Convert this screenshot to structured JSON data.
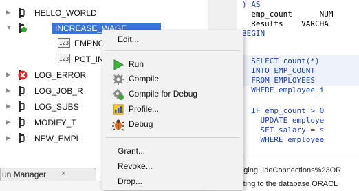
{
  "tree": {
    "items": [
      {
        "label": "HELLO_WORLD",
        "icon": "procedure-icon"
      },
      {
        "label": "INCREASE_WAGE",
        "icon": "procedure-debug-icon",
        "selected": true
      },
      {
        "label": "EMPNO",
        "icon": "parameter-icon"
      },
      {
        "label": "PCT_IN",
        "icon": "parameter-icon"
      },
      {
        "label": "LOG_ERROR",
        "icon": "procedure-error-icon"
      },
      {
        "label": "LOG_JOB_R",
        "icon": "procedure-icon"
      },
      {
        "label": "LOG_SUBS",
        "icon": "procedure-icon"
      },
      {
        "label": "MODIFY_T",
        "icon": "procedure-icon"
      },
      {
        "label": "NEW_EMPL",
        "icon": "procedure-icon"
      }
    ],
    "param_badge": "123"
  },
  "context_menu": {
    "edit": "Edit...",
    "run": "Run",
    "compile": "Compile",
    "compile_debug": "Compile for Debug",
    "profile": "Profile...",
    "debug": "Debug",
    "grant": "Grant...",
    "revoke": "Revoke...",
    "drop": "Drop..."
  },
  "editor": {
    "lines": [
      {
        "t": ") AS",
        "kw": true
      },
      {
        "t": "  emp_count      NUM",
        "kw": false
      },
      {
        "t": "  Results    VARCHA",
        "kw": false
      },
      {
        "t": "BEGIN",
        "kw": true
      },
      {
        "t": "",
        "kw": false
      },
      {
        "t": "  SELECT count(*)",
        "kw": true
      },
      {
        "t": "  INTO EMP_COUNT",
        "kw": true
      },
      {
        "t": "  FROM EMPLOYEES",
        "kw": true
      },
      {
        "t": "  WHERE employee_i",
        "kw": true
      },
      {
        "t": "",
        "kw": false
      },
      {
        "t": "  IF emp_count > 0",
        "kw": true
      },
      {
        "t": "    UPDATE employe",
        "kw": true
      },
      {
        "t": "    SET salary = s",
        "kw": true
      },
      {
        "t": "    WHERE employee",
        "kw": true
      }
    ]
  },
  "bottom": {
    "tab_label": "un Manager",
    "tab_close": "×",
    "log_line1": "ugging: IdeConnections%23OR",
    "log_line2": "ecting to the database ORACL"
  },
  "colors": {
    "selection": "#3875d7",
    "keyword": "#1c3fa8",
    "run_green": "#3fb23a"
  }
}
